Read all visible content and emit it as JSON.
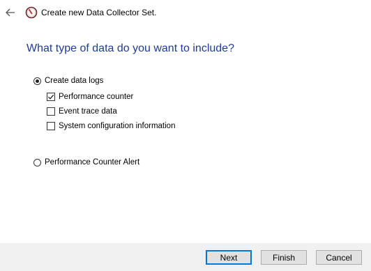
{
  "window": {
    "title": "Create new Data Collector Set.",
    "back_icon": "arrow-left-icon",
    "app_icon": "performance-monitor-icon"
  },
  "page": {
    "heading": "What type of data do you want to include?"
  },
  "options": {
    "create_data_logs": {
      "label": "Create data logs",
      "selected": true
    },
    "performance_counter": {
      "label": "Performance counter",
      "checked": true
    },
    "event_trace_data": {
      "label": "Event trace data",
      "checked": false
    },
    "system_configuration": {
      "label": "System configuration information",
      "checked": false
    },
    "performance_counter_alert": {
      "label": "Performance Counter Alert",
      "selected": false
    }
  },
  "buttons": {
    "next": "Next",
    "finish": "Finish",
    "cancel": "Cancel"
  },
  "colors": {
    "heading": "#1e3c96",
    "default_button_border": "#0078d7",
    "footer_bg": "#f0f0f0"
  }
}
